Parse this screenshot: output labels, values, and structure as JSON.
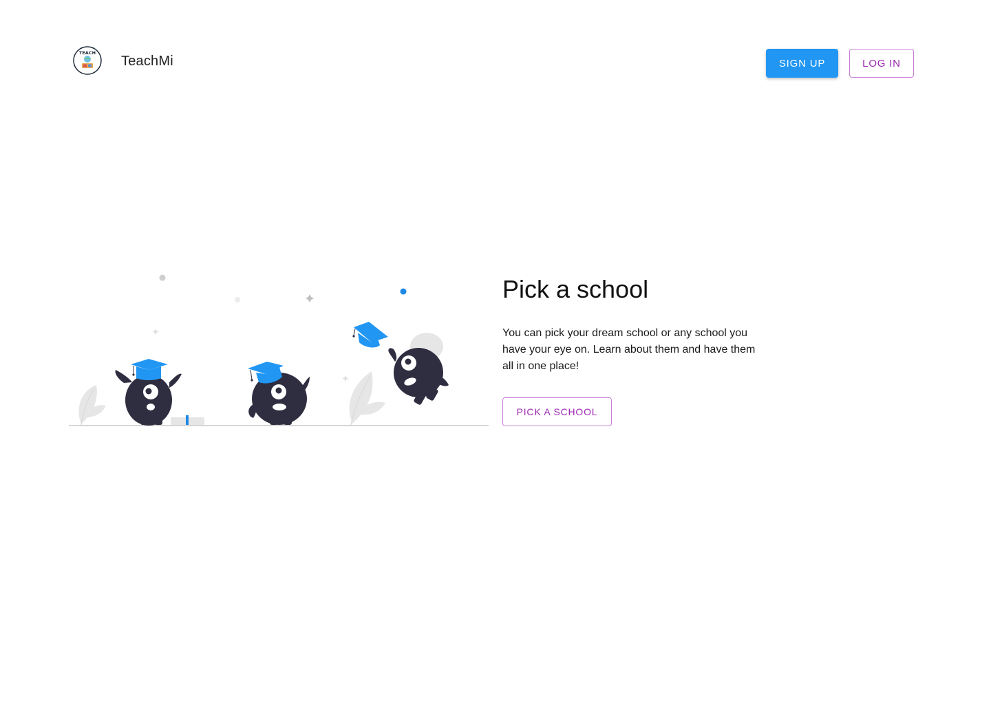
{
  "header": {
    "logo_text": "TEACH",
    "brand": "TeachMi",
    "signup_label": "SIGN UP",
    "login_label": "LOG IN"
  },
  "hero": {
    "title": "Pick a school",
    "description": "You can pick your dream school or any school you have your eye on. Learn about them and have them all in one place!",
    "cta_label": "PICK A SCHOOL"
  },
  "colors": {
    "primary_blue": "#2196f3",
    "accent_purple": "#9c27b0",
    "creature_dark": "#2f2e41",
    "leaf_gray": "#e6e6e6"
  }
}
